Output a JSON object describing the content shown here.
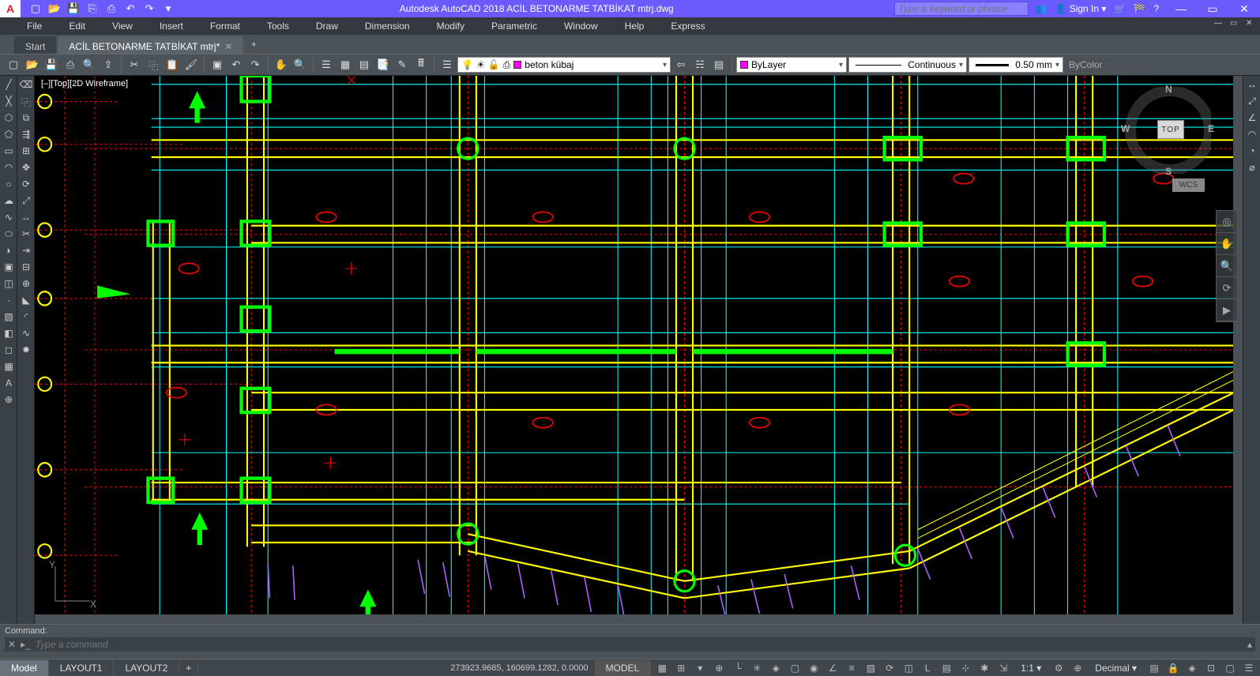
{
  "app": {
    "title": "Autodesk AutoCAD 2018    ACİL BETONARME TATBİKAT mtrj.dwg",
    "logo": "A"
  },
  "qat": [
    "▤",
    "▤",
    "✎",
    "⎋",
    "↶",
    "↷",
    "⎙"
  ],
  "title_right": {
    "search_placeholder": "Type a keyword or phrase",
    "signin": "Sign In"
  },
  "menubar": [
    "File",
    "Edit",
    "View",
    "Insert",
    "Format",
    "Tools",
    "Draw",
    "Dimension",
    "Modify",
    "Parametric",
    "Window",
    "Help",
    "Express"
  ],
  "doctabs": {
    "start": "Start",
    "active": "ACİL BETONARME TATBİKAT mtrj*"
  },
  "toolbar": {
    "layer_current": "beton kübaj",
    "layer_swatch": "#ff00ff",
    "color": "ByLayer",
    "color_swatch": "#ff00ff",
    "linetype": "Continuous",
    "lineweight": "0.50 mm",
    "plotstyle": "ByColor"
  },
  "viewport": {
    "label": "[–][Top][2D Wireframe]",
    "wcs": "WCS",
    "viewcube_face": "TOP",
    "n": "N",
    "s": "S",
    "e": "E",
    "w": "W"
  },
  "command": {
    "history": "Command:",
    "placeholder": "Type a command"
  },
  "status": {
    "tabs": [
      "Model",
      "LAYOUT1",
      "LAYOUT2"
    ],
    "coords": "273923.9685, 160699.1282, 0.0000",
    "model": "MODEL",
    "scale": "1:1",
    "units": "Decimal"
  }
}
